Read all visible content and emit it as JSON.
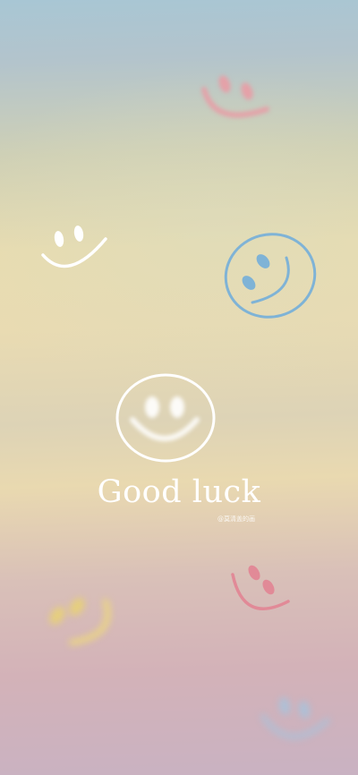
{
  "wallpaper": {
    "tagline": "Good luck",
    "watermark": "@莫清盖的画"
  },
  "colors": {
    "white": "#ffffff",
    "blue": "#7fb3d6",
    "pink": "#e18a97",
    "yellow": "#e6cf7c"
  },
  "icons": [
    "smiley-icon-pink",
    "smiley-icon-white",
    "smiley-icon-blue",
    "smiley-icon-white-center",
    "smiley-icon-yellow",
    "smiley-icon-pink-small",
    "smiley-icon-blue-faded"
  ]
}
